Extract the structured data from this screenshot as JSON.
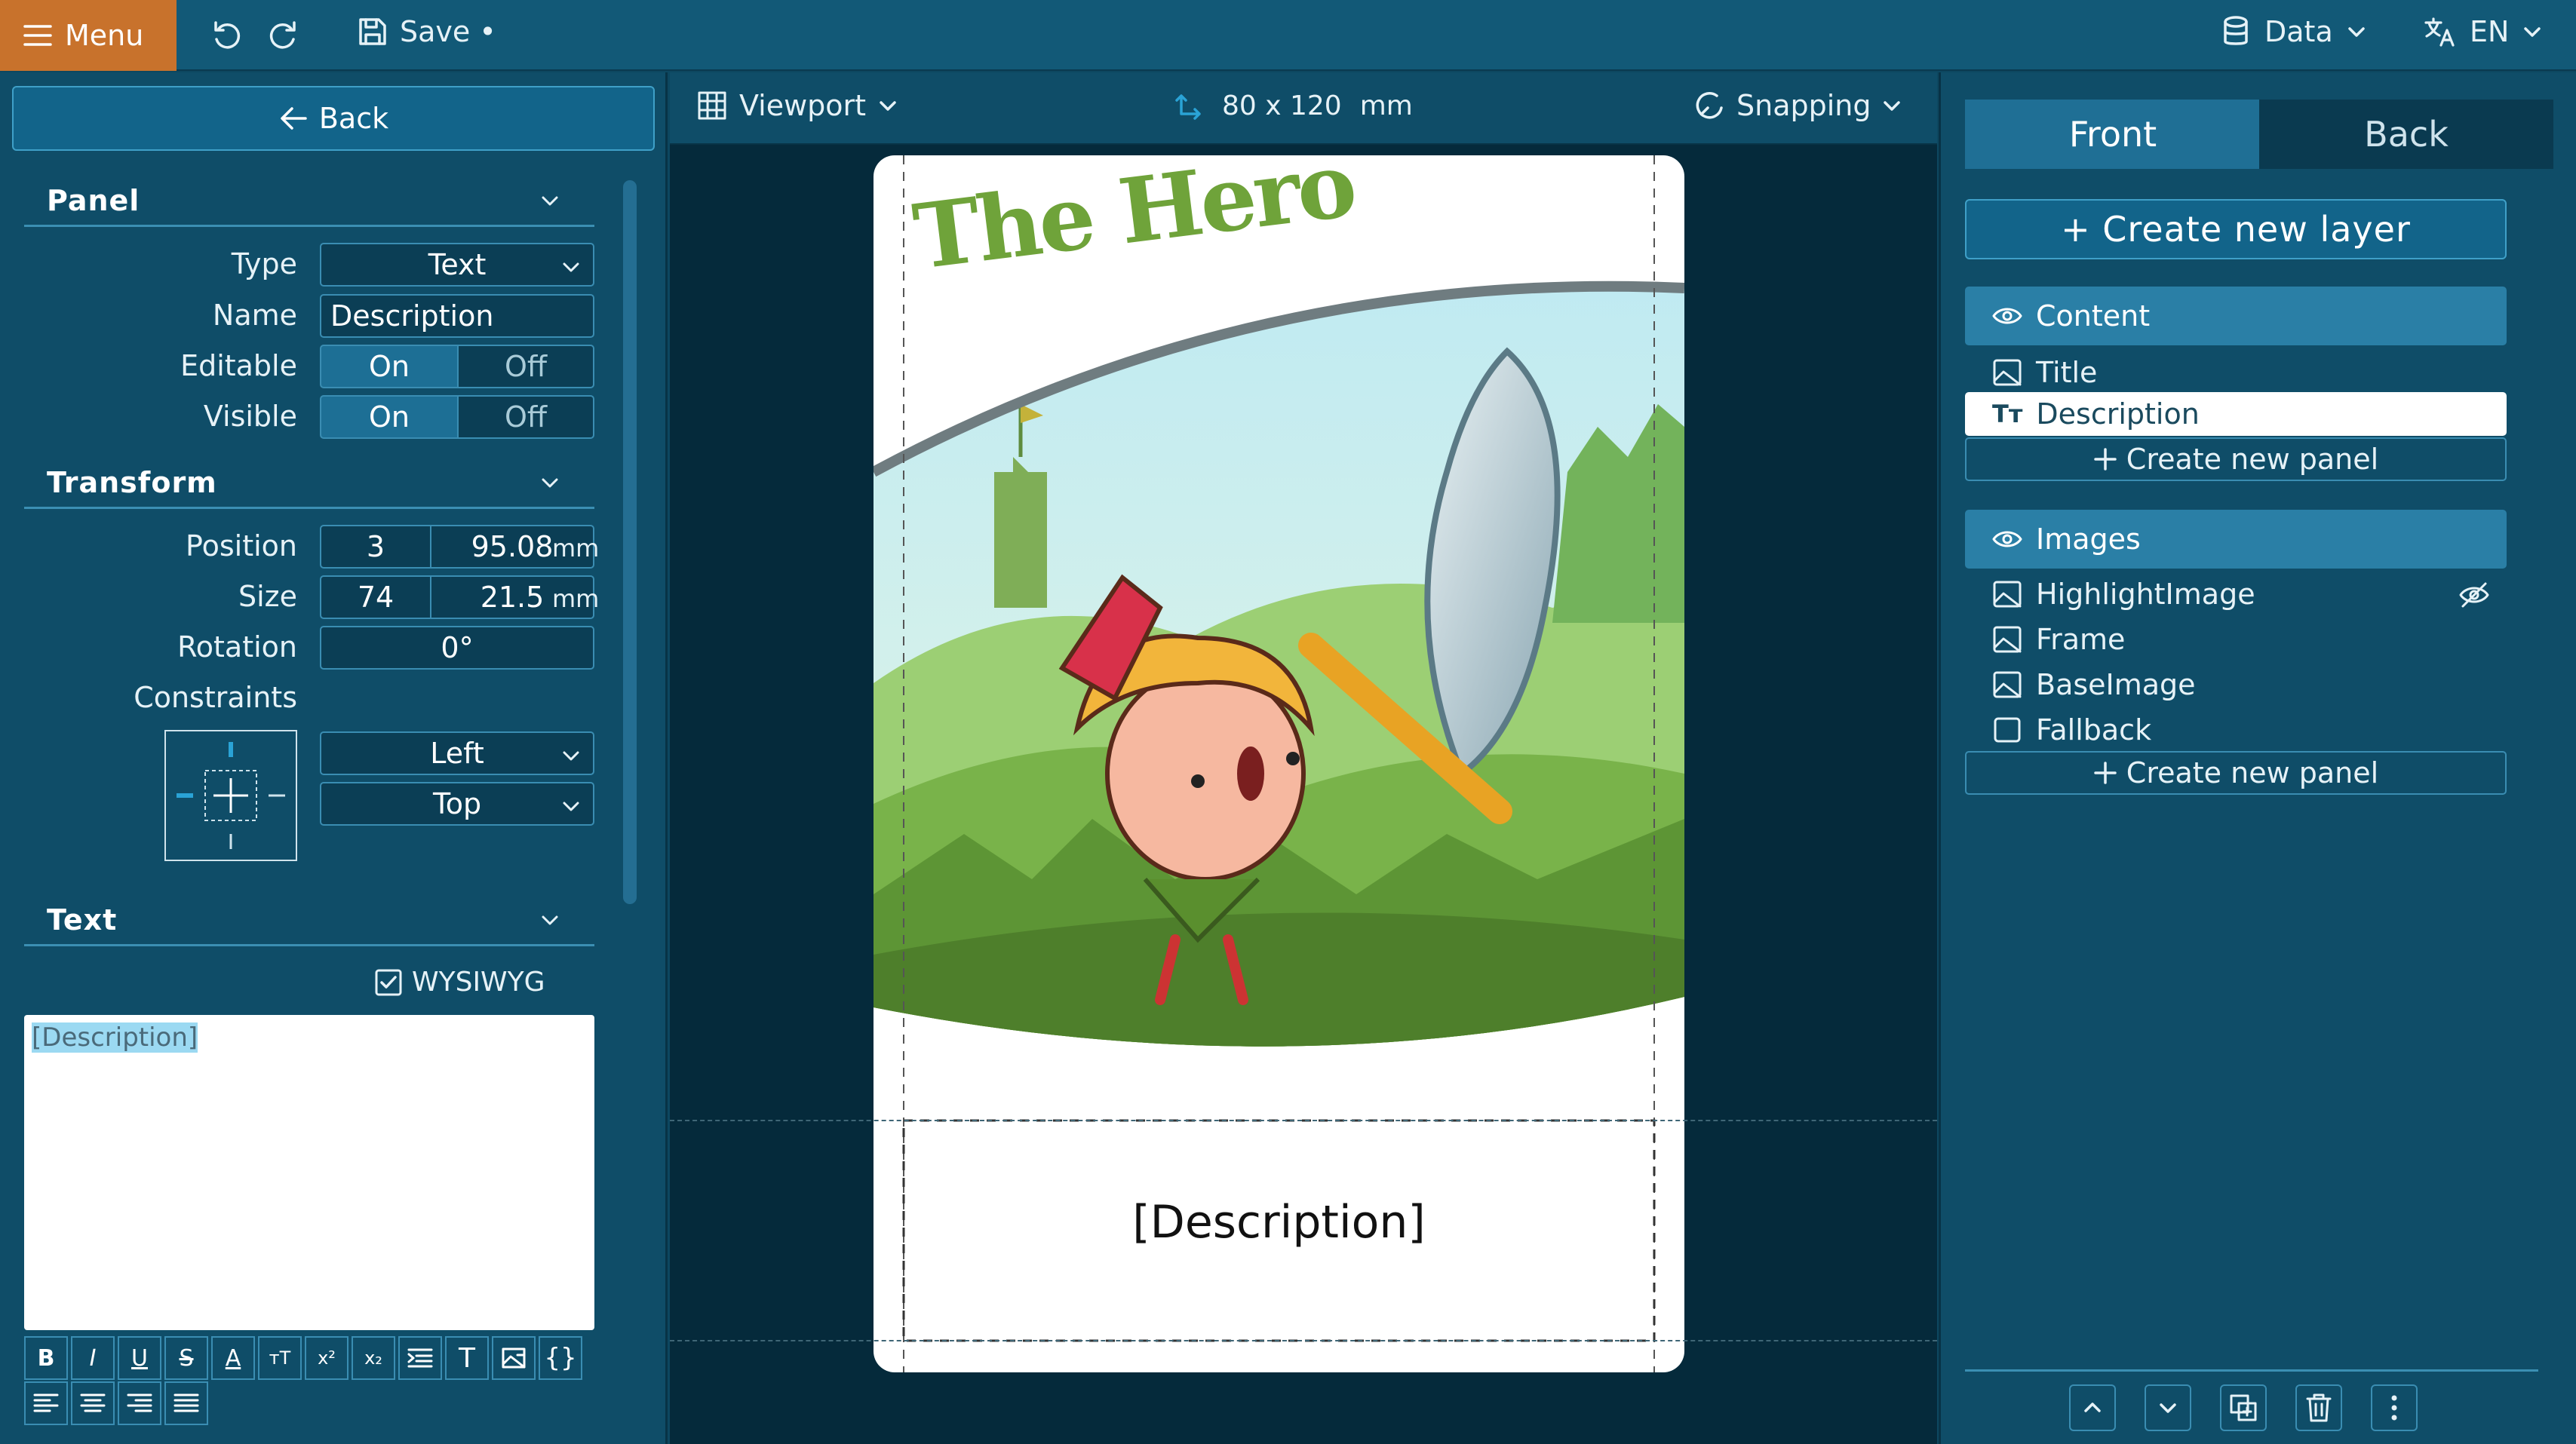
{
  "topbar": {
    "menu_label": "Menu",
    "save_label": "Save •",
    "data_label": "Data",
    "lang_label": "EN"
  },
  "left_panel": {
    "back_label": "Back",
    "panel_section": {
      "title": "Panel",
      "type_label": "Type",
      "type_value": "Text",
      "name_label": "Name",
      "name_value": "Description",
      "editable_label": "Editable",
      "visible_label": "Visible",
      "on_label": "On",
      "off_label": "Off"
    },
    "transform_section": {
      "title": "Transform",
      "position_label": "Position",
      "position_x": "3",
      "position_y": "95.08",
      "size_label": "Size",
      "size_w": "74",
      "size_h": "21.5",
      "unit": "mm",
      "rotation_label": "Rotation",
      "rotation_value": "0°",
      "constraints_label": "Constraints",
      "constraint_h": "Left",
      "constraint_v": "Top"
    },
    "text_section": {
      "title": "Text",
      "wysiwyg_label": "WYSIWYG",
      "editor_value": "[Description]"
    }
  },
  "center": {
    "viewport_label": "Viewport",
    "card_size": "80 x 120",
    "card_unit": "mm",
    "snapping_label": "Snapping",
    "card_title": "The Hero",
    "card_description": "[Description]"
  },
  "right_panel": {
    "tab_front": "Front",
    "tab_back": "Back",
    "create_layer": "+ Create new layer",
    "groups": [
      {
        "name": "Content",
        "items": [
          {
            "label": "Title",
            "icon": "image-icon"
          },
          {
            "label": "Description",
            "icon": "text-type-icon",
            "selected": true
          }
        ],
        "create_panel": "Create new panel"
      },
      {
        "name": "Images",
        "items": [
          {
            "label": "HighlightImage",
            "icon": "image-icon",
            "hidden": true
          },
          {
            "label": "Frame",
            "icon": "image-icon"
          },
          {
            "label": "BaseImage",
            "icon": "image-icon"
          },
          {
            "label": "Fallback",
            "icon": "square-icon"
          }
        ],
        "create_panel": "Create new panel"
      }
    ]
  },
  "colors": {
    "accent_orange": "#c8722c",
    "panel_bg": "#0f4d68",
    "canvas_bg": "#052a3b",
    "group_head": "#2a7fa6"
  }
}
